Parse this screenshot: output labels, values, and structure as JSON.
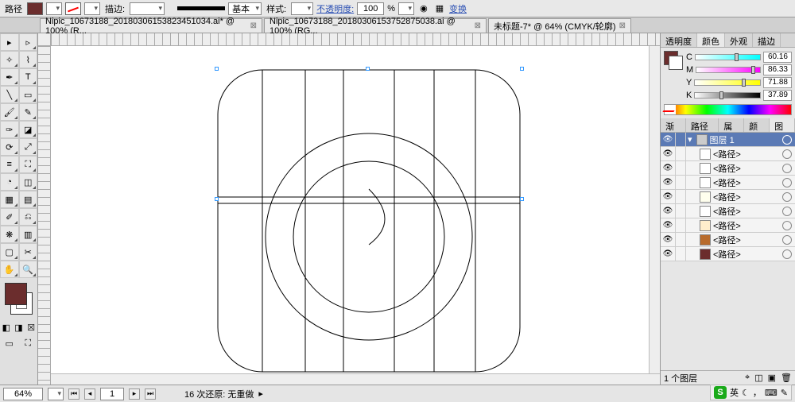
{
  "options_bar": {
    "context": "路径",
    "stroke_label": "描边:",
    "stroke_weight": "",
    "stroke_type": "基本",
    "style_label": "样式:",
    "opacity_label": "不透明度:",
    "opacity_value": "100",
    "transform": "变换"
  },
  "tabs": [
    {
      "label": "Nipic_10673188_20180306153823451034.ai* @ 100% (R..."
    },
    {
      "label": "Nipic_10673188_20180306153752875038.ai @ 100% (RG..."
    },
    {
      "label": "未标题-7* @ 64% (CMYK/轮廓)"
    }
  ],
  "color_panel": {
    "tabs": [
      "透明度",
      "颜色",
      "外观",
      "描边"
    ],
    "active_tab": "颜色",
    "channels": [
      {
        "name": "C",
        "value": "60.16",
        "thumb": 60
      },
      {
        "name": "M",
        "value": "86.33",
        "thumb": 86
      },
      {
        "name": "Y",
        "value": "71.88",
        "thumb": 72
      },
      {
        "name": "K",
        "value": "37.89",
        "thumb": 38
      }
    ]
  },
  "layers_panel": {
    "tabs": [
      "渐变",
      "路径查",
      "属性",
      "颜色",
      "图层"
    ],
    "active_tab": "图层",
    "layer_name": "图层 1",
    "sublayers": [
      {
        "name": "<路径>",
        "thumb": "#ffffff"
      },
      {
        "name": "<路径>",
        "thumb": "#ffffff"
      },
      {
        "name": "<路径>",
        "thumb": "#ffffff"
      },
      {
        "name": "<路径>",
        "thumb": "#ffffee"
      },
      {
        "name": "<路径>",
        "thumb": "#ffffff"
      },
      {
        "name": "<路径>",
        "thumb": "#ffeecc"
      },
      {
        "name": "<路径>",
        "thumb": "#b86b2b"
      },
      {
        "name": "<路径>",
        "thumb": "#6b2d2d"
      }
    ],
    "footer": "1 个图层"
  },
  "status": {
    "zoom": "64%",
    "page": "1",
    "undo": "16 次还原: 无重做"
  },
  "ime": {
    "label": "英"
  }
}
